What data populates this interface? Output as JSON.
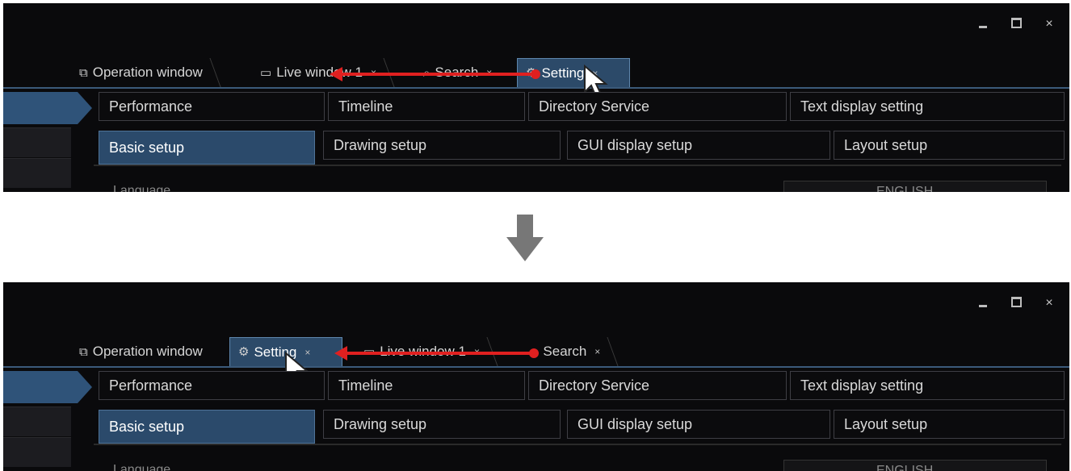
{
  "window_controls": {
    "minimize": "–",
    "maximize": "□",
    "close": "×"
  },
  "before": {
    "tabs": [
      {
        "label": "Operation window",
        "icon": "operation-window-icon"
      },
      {
        "label": "Live window 1",
        "icon": "monitor-icon",
        "close": "×"
      },
      {
        "label": "Search",
        "icon": "search-icon",
        "close": "×"
      },
      {
        "label": "Setting",
        "icon": "gear-icon",
        "close": "×"
      }
    ]
  },
  "after": {
    "tabs": [
      {
        "label": "Operation window",
        "icon": "operation-window-icon"
      },
      {
        "label": "Setting",
        "icon": "gear-icon",
        "close": "×"
      },
      {
        "label": "Live window 1",
        "icon": "monitor-icon",
        "close": "×"
      },
      {
        "label": "Search",
        "icon": "search-icon",
        "close": "×"
      }
    ]
  },
  "category_tabs": [
    "Performance",
    "Timeline",
    "Directory Service",
    "Text display setting"
  ],
  "sub_tabs": [
    "Basic setup",
    "Drawing setup",
    "GUI display setup",
    "Layout setup"
  ],
  "partial_row": {
    "label": "Language",
    "value": "ENGLISH"
  },
  "colors": {
    "accent": "#2c4a69",
    "arrow": "#e02020",
    "background": "#0a0a0c"
  }
}
